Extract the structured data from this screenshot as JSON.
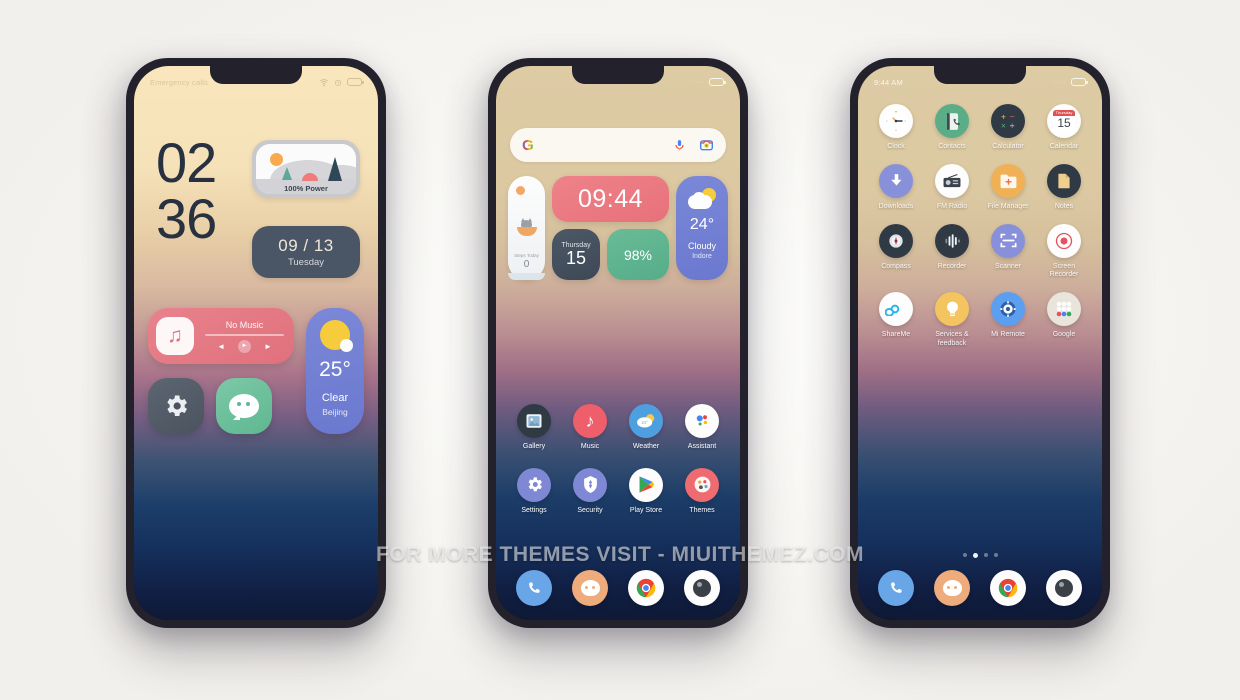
{
  "watermark": "FOR MORE THEMES VISIT - MIUITHEMEZ.COM",
  "colors": {
    "bezel": "#23222c",
    "lock_text": "#27313f",
    "music_pink": "#e0717c",
    "weather_purple": "#6a78cf",
    "settings_slate": "#4a535e",
    "wechat_green": "#5eb890",
    "calendar_slate": "#3d4956",
    "battery_green": "#57ad89",
    "page_bg": "#fbfaf8"
  },
  "phone1": {
    "statusbar": {
      "left": "Emergency calls"
    },
    "clock": {
      "hours": "02",
      "minutes": "36"
    },
    "power_widget": {
      "label": "100% Power"
    },
    "date_widget": {
      "date": "09 / 13",
      "weekday": "Tuesday"
    },
    "music_widget": {
      "title": "No Music"
    },
    "tiles": [
      {
        "name": "settings",
        "label": "Settings"
      },
      {
        "name": "wechat",
        "label": "WeChat"
      }
    ],
    "weather_widget": {
      "temp": "25°",
      "condition": "Clear",
      "city": "Beijing"
    }
  },
  "phone2": {
    "search": {
      "placeholder": "",
      "value": ""
    },
    "clock_widget": {
      "time": "09:44"
    },
    "steps_widget": {
      "label": "Steps Today",
      "value": "0"
    },
    "calendar_widget": {
      "weekday": "Thursday",
      "day": "15"
    },
    "battery_widget": {
      "value": "98%"
    },
    "weather_widget": {
      "temp": "24°",
      "condition": "Cloudy",
      "city": "Indore"
    },
    "apps": [
      {
        "label": "Gallery",
        "icon": "gallery-icon"
      },
      {
        "label": "Music",
        "icon": "music-icon"
      },
      {
        "label": "Weather",
        "icon": "weather-icon"
      },
      {
        "label": "Assistant",
        "icon": "assistant-icon"
      },
      {
        "label": "Settings",
        "icon": "settings-icon"
      },
      {
        "label": "Security",
        "icon": "security-icon"
      },
      {
        "label": "Play Store",
        "icon": "play-store-icon"
      },
      {
        "label": "Themes",
        "icon": "themes-icon"
      }
    ]
  },
  "phone3": {
    "statusbar": {
      "left": "9:44 AM"
    },
    "apps": [
      {
        "label": "Clock",
        "icon": "clock-icon"
      },
      {
        "label": "Contacts",
        "icon": "contacts-icon"
      },
      {
        "label": "Calculator",
        "icon": "calculator-icon"
      },
      {
        "label": "Calendar",
        "icon": "calendar-icon"
      },
      {
        "label": "Downloads",
        "icon": "downloads-icon"
      },
      {
        "label": "FM Radio",
        "icon": "fm-radio-icon"
      },
      {
        "label": "File Manager",
        "icon": "file-manager-icon"
      },
      {
        "label": "Notes",
        "icon": "notes-icon"
      },
      {
        "label": "Compass",
        "icon": "compass-icon"
      },
      {
        "label": "Recorder",
        "icon": "recorder-icon"
      },
      {
        "label": "Scanner",
        "icon": "scanner-icon"
      },
      {
        "label": "Screen Recorder",
        "icon": "screen-recorder-icon"
      },
      {
        "label": "ShareMe",
        "icon": "shareme-icon"
      },
      {
        "label": "Services & feedback",
        "icon": "services-feedback-icon"
      },
      {
        "label": "Mi Remote",
        "icon": "mi-remote-icon"
      },
      {
        "label": "Google",
        "icon": "google-folder-icon"
      }
    ],
    "calendar_icon_day": "15",
    "page_indicator": {
      "count": 4,
      "active": 2
    }
  },
  "dock": [
    {
      "label": "Phone",
      "icon": "phone-icon"
    },
    {
      "label": "Messages",
      "icon": "messages-icon"
    },
    {
      "label": "Chrome",
      "icon": "chrome-icon"
    },
    {
      "label": "Camera",
      "icon": "camera-icon"
    }
  ]
}
